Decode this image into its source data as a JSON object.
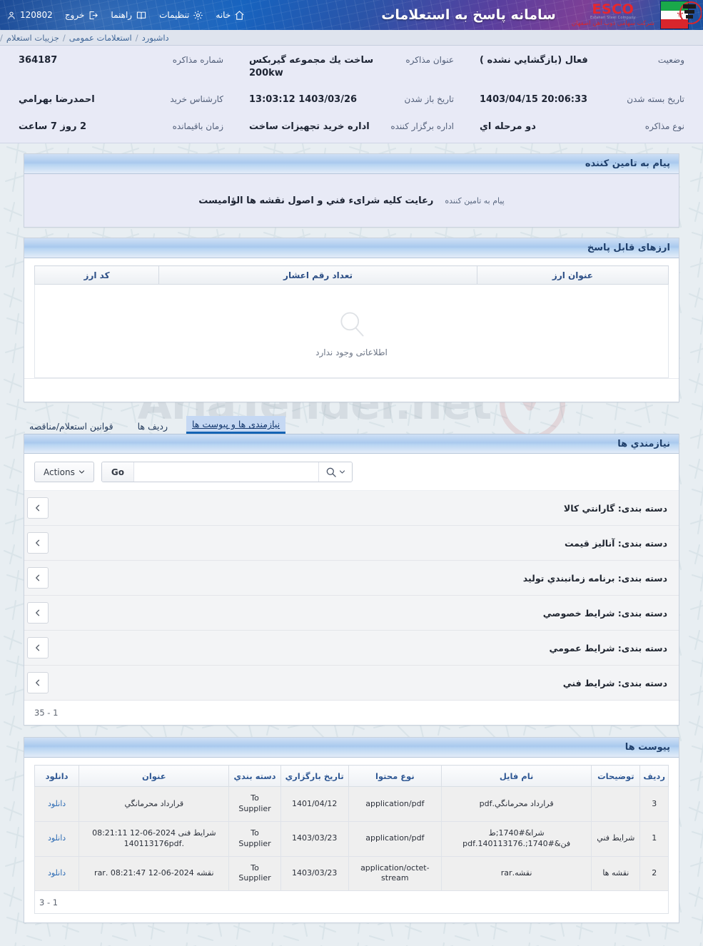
{
  "header": {
    "app_title": "سامانه پاسخ به استعلامات",
    "logo": {
      "esco_main": "ESCO",
      "esco_sub": "Esfahan Steel Company",
      "esco_fa": "شرکت سهامی ذوب آهن اصفهان"
    },
    "nav": [
      {
        "label": "خانه",
        "icon": "home-icon"
      },
      {
        "label": "تنظیمات",
        "icon": "gear-icon"
      },
      {
        "label": "راهنما",
        "icon": "book-icon"
      },
      {
        "label": "خروج",
        "icon": "logout-icon"
      },
      {
        "label": "120802",
        "icon": "user-icon"
      }
    ]
  },
  "breadcrumb": {
    "items": [
      "داشبورد",
      "استعلامات عمومی",
      "جزییات استعلام"
    ],
    "separator": "/"
  },
  "summary": {
    "cells": [
      {
        "label": "وضعیت",
        "value": "فعال (بازگشايي نشده )",
        "ltr": false
      },
      {
        "label": "عنوان مذاکره",
        "value": "ساخت يك مجموعه گيربكس 200kw",
        "ltr": false
      },
      {
        "label": "شماره مذاکره",
        "value": "364187",
        "ltr": true
      },
      {
        "label": "تاریخ بسته شدن",
        "value": "1403/04/15 20:06:33",
        "ltr": true
      },
      {
        "label": "تاریخ باز شدن",
        "value": "13:03:12 1403/03/26",
        "ltr": true
      },
      {
        "label": "کارشناس خرید",
        "value": "احمدرضا بهرامي",
        "ltr": false
      },
      {
        "label": "نوع مذاکره",
        "value": "دو مرحله اي",
        "ltr": false
      },
      {
        "label": "اداره برگزار کننده",
        "value": "اداره خريد تجهيزات ساخت",
        "ltr": false
      },
      {
        "label": "زمان باقیمانده",
        "value": "2 روز 7 ساعت",
        "ltr": false
      }
    ]
  },
  "message_panel": {
    "title": "پیام به تامین کننده",
    "label": "پیام به تامین کننده",
    "value": "رعایت کلیه شرایء فني و اصول نقشه ها الؤامیست"
  },
  "currency_panel": {
    "title": "ارزهای قابل پاسخ",
    "columns": [
      "عنوان ارز",
      "تعداد رقم اعشار",
      "کد ارز"
    ],
    "empty_text": "اطلاعاتی وجود ندارد"
  },
  "tabs": [
    {
      "label": "نیازمندی ها و پیوست ها",
      "active": true
    },
    {
      "label": "ردیف ها",
      "active": false
    },
    {
      "label": "قوانین استعلام/مناقصه",
      "active": false
    }
  ],
  "requirements": {
    "title": "نیازمندي ها",
    "search_value": "",
    "search_placeholder": "",
    "go_label": "Go",
    "actions_label": "Actions",
    "rows": [
      {
        "label": "دسته بندی: گارانتي کالا"
      },
      {
        "label": "دسته بندی: آنالیز قیمت"
      },
      {
        "label": "دسته بندی: برنامه زمانبندي تولید"
      },
      {
        "label": "دسته بندی: شرایط خصوصي"
      },
      {
        "label": "دسته بندی: شرایط عمومي"
      },
      {
        "label": "دسته بندی: شرایط فني"
      }
    ],
    "pagination": "35 - 1"
  },
  "attachments": {
    "title": "پیوست ها",
    "columns": [
      "ردیف",
      "توضیحات",
      "نام فایل",
      "نوع محتوا",
      "تاریخ بارگزاري",
      "دسته بندي",
      "عنوان",
      "دانلود"
    ],
    "rows": [
      {
        "radif": "3",
        "tozihat": "",
        "file_name": "قرارداد محرمانگي.pdf",
        "content_type": "application/pdf",
        "upload_date": "1401/04/12",
        "category": "To Supplier",
        "title": "قرارداد محرمانگي",
        "download_label": "دانلود"
      },
      {
        "radif": "1",
        "tozihat": "شرایط فني",
        "file_name": "شرا&#1740;ط فن&#1740;.140113176.pdf",
        "content_type": "application/pdf",
        "upload_date": "1403/03/23",
        "category": "To Supplier",
        "title": "شرایط فنی 2024-06-12 08:21:11 .140113176pdf",
        "download_label": "دانلود"
      },
      {
        "radif": "2",
        "tozihat": "نقشه ها",
        "file_name": "نقشه.rar",
        "content_type": "application/octet-stream",
        "upload_date": "1403/03/23",
        "category": "To Supplier",
        "title": "نقشه 2024-06-12 08:21:47 .rar",
        "download_label": "دانلود"
      }
    ],
    "pagination": "3 - 1"
  },
  "watermark": {
    "text": "AriaTender.net"
  }
}
